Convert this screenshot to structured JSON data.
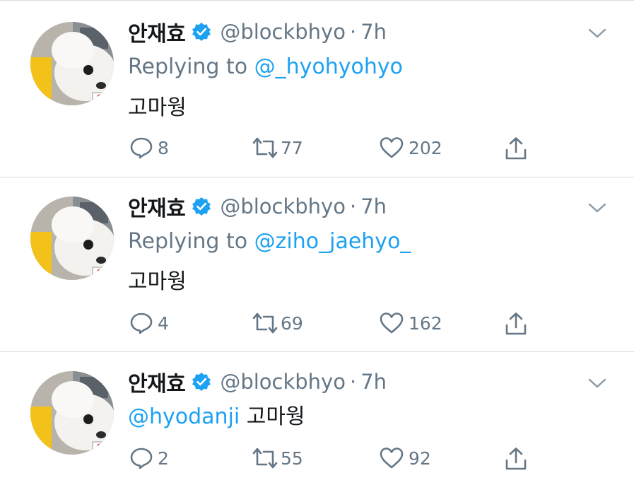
{
  "tweets": [
    {
      "name": "안재효",
      "handle": "@blockbhyo",
      "separator": "·",
      "time": "7h",
      "replying_prefix": "Replying to ",
      "replying_to": "@_hyohyohyo",
      "text": "고마웡",
      "mention_inline": "",
      "counts": {
        "replies": "8",
        "retweets": "77",
        "likes": "202"
      }
    },
    {
      "name": "안재효",
      "handle": "@blockbhyo",
      "separator": "·",
      "time": "7h",
      "replying_prefix": "Replying to ",
      "replying_to": "@ziho_jaehyo_",
      "text": "고마웡",
      "mention_inline": "",
      "counts": {
        "replies": "4",
        "retweets": "69",
        "likes": "162"
      }
    },
    {
      "name": "안재효",
      "handle": "@blockbhyo",
      "separator": "·",
      "time": "7h",
      "replying_prefix": "",
      "replying_to": "",
      "text": "고마웡",
      "mention_inline": "@hyodanji",
      "counts": {
        "replies": "2",
        "retweets": "55",
        "likes": "92"
      }
    }
  ],
  "icons": {
    "verified": "verified-badge-icon",
    "caret": "chevron-down-icon",
    "reply": "reply-bubble-icon",
    "retweet": "retweet-icon",
    "like": "heart-icon",
    "share": "share-upload-icon"
  },
  "colors": {
    "link": "#1da1f2",
    "secondary": "#657786",
    "text": "#14171a",
    "divider": "#d8dde1"
  }
}
